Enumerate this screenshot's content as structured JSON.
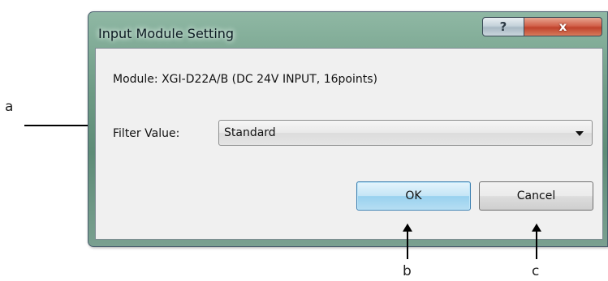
{
  "dialog": {
    "title": "Input Module Setting",
    "help_button": "?",
    "close_button": "x",
    "module_text": "Module:  XGI-D22A/B (DC 24V INPUT, 16points)",
    "filter_label": "Filter Value:",
    "filter_value": "Standard",
    "ok_label": "OK",
    "cancel_label": "Cancel"
  },
  "annotations": {
    "a": "a",
    "b": "b",
    "c": "c"
  }
}
